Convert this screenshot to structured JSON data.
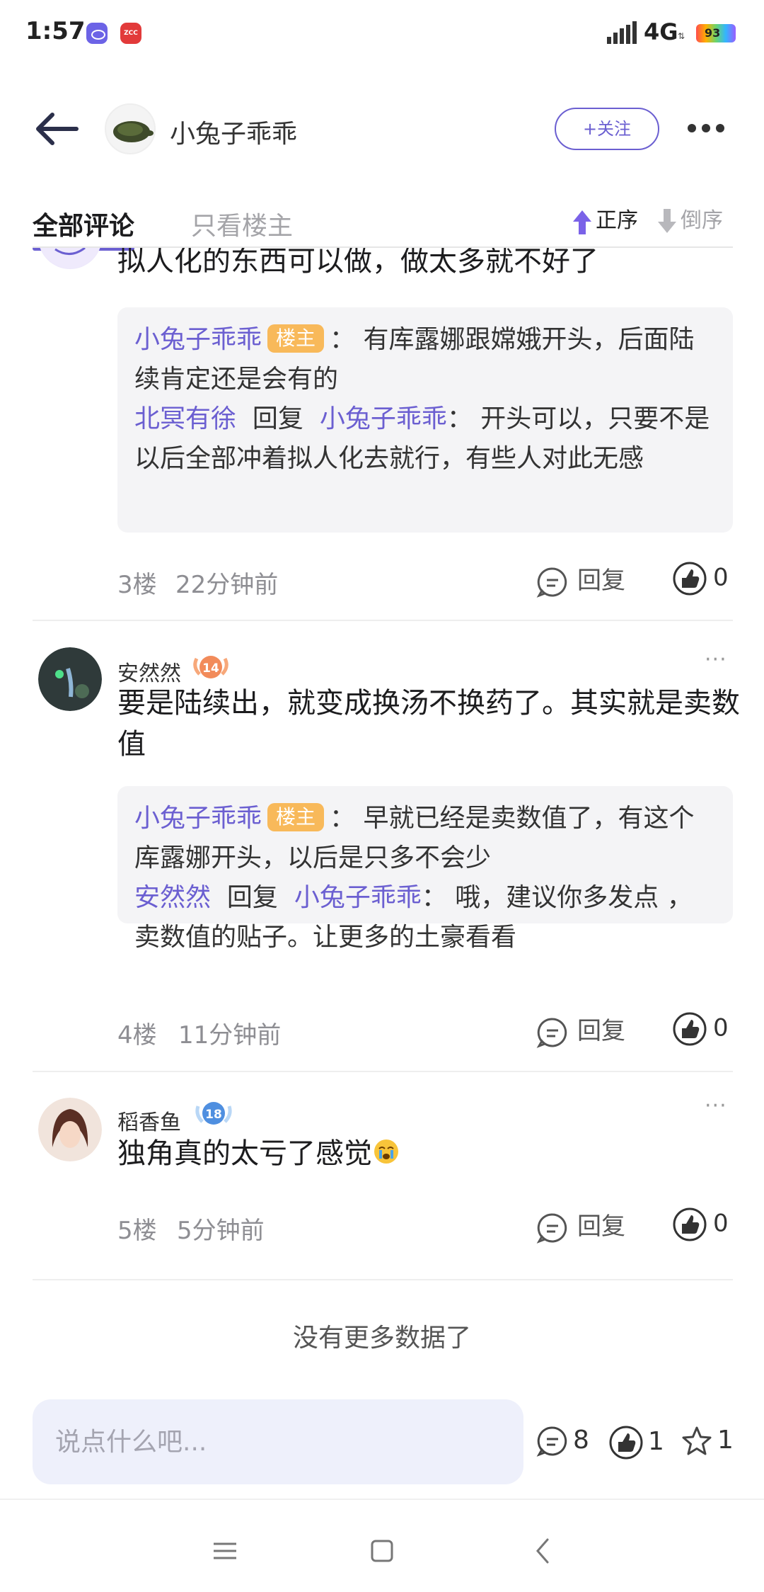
{
  "status_bar": {
    "time": "1:57",
    "network": "4G",
    "battery": "93",
    "app2_label": "ZCC"
  },
  "header": {
    "author_name": "小兔子乖乖",
    "follow_label": "+关注"
  },
  "tabs": {
    "all_label": "全部评论",
    "op_only_label": "只看楼主",
    "sort_asc_label": "正序",
    "sort_desc_label": "倒序"
  },
  "comments": [
    {
      "text": "拟人化的东西可以做，做太多就不好了",
      "replies": [
        {
          "author": "小兔子乖乖",
          "is_op": true,
          "op_tag": "楼主",
          "text": "有库露娜跟嫦娥开头，后面陆续肯定还是会有的"
        },
        {
          "author": "北冥有徐",
          "reply_word": "回复",
          "target": "小兔子乖乖",
          "text": "开头可以，只要不是以后全部冲着拟人化去就行，有些人对此无感"
        }
      ],
      "floor": "3楼",
      "time": "22分钟前",
      "reply_label": "回复",
      "likes": "0"
    },
    {
      "user": "安然然",
      "level": "14",
      "text": "要是陆续出，就变成换汤不换药了。其实就是卖数值",
      "replies": [
        {
          "author": "小兔子乖乖",
          "is_op": true,
          "op_tag": "楼主",
          "text": "早就已经是卖数值了，有这个库露娜开头，以后是只多不会少"
        },
        {
          "author": "安然然",
          "reply_word": "回复",
          "target": "小兔子乖乖",
          "text": "哦，建议你多发点 ，卖数值的贴子。让更多的土豪看看"
        }
      ],
      "floor": "4楼",
      "time": "11分钟前",
      "reply_label": "回复",
      "likes": "0"
    },
    {
      "user": "稻香鱼",
      "level": "18",
      "text": "独角真的太亏了感觉",
      "floor": "5楼",
      "time": "5分钟前",
      "reply_label": "回复",
      "likes": "0"
    }
  ],
  "no_more_text": "没有更多数据了",
  "bottom_bar": {
    "input_placeholder": "说点什么吧...",
    "comment_count": "8",
    "like_count": "1",
    "star_count": "1"
  },
  "colors": {
    "accent": "#6b5fd1",
    "op_tag": "#f8b95a",
    "reply_bg": "#f4f4f6",
    "input_bg": "#eef0fb"
  }
}
